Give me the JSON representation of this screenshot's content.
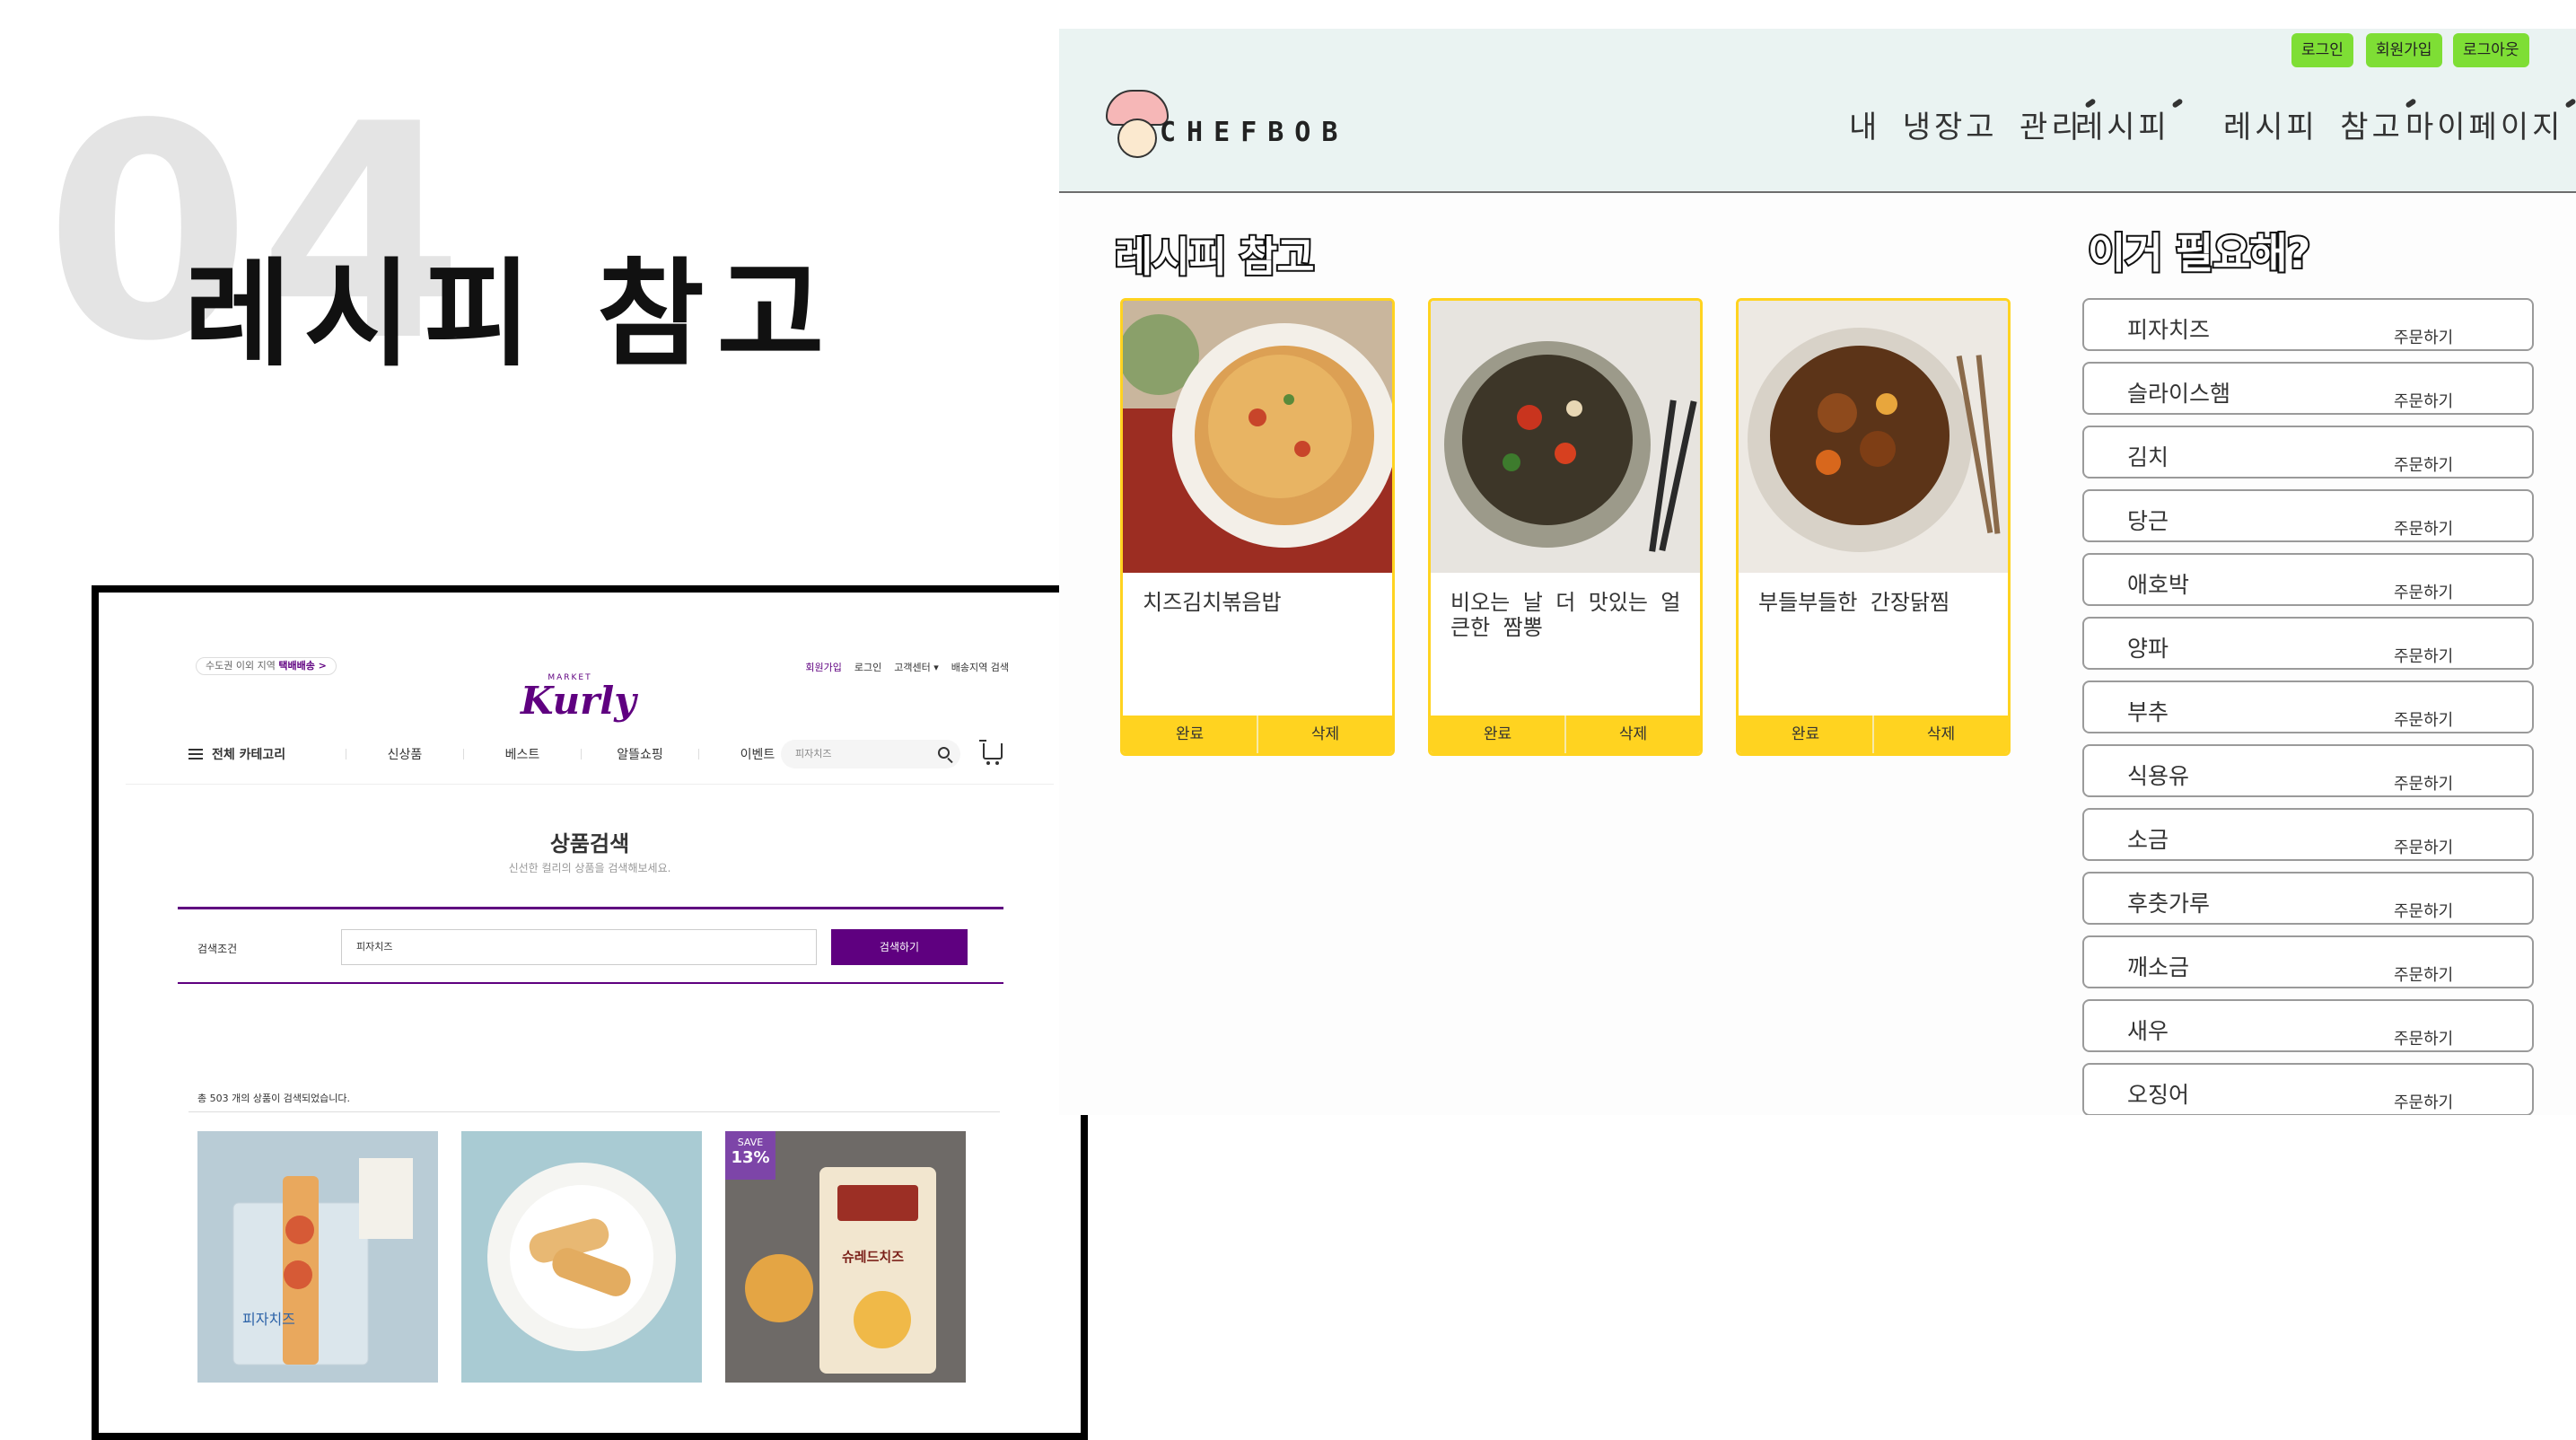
{
  "slide": {
    "number": "04",
    "title": "레시피 참고"
  },
  "kurly": {
    "delivery_text": "수도권 이외 지역",
    "delivery_badge": "택배배송 >",
    "top_links": [
      "회원가입",
      "로그인",
      "고객센터 ▾",
      "배송지역 검색"
    ],
    "logo_small": "MARKET",
    "logo": "Kurly",
    "nav": {
      "category": "전체 카테고리",
      "items": [
        "신상품",
        "베스트",
        "알뜰쇼핑",
        "이벤트"
      ]
    },
    "search_placeholder": "피자치즈",
    "page_title": "상품검색",
    "page_subtitle": "신선한 컬리의 상품을 검색해보세요.",
    "search_label": "검색조건",
    "search_value": "피자치즈",
    "search_button": "검색하기",
    "result_count": "총 503 개의 상품이 검색되었습니다.",
    "save_badge": {
      "line1": "SAVE",
      "line2": "13%"
    },
    "product_texts": [
      "피자치즈",
      "슈레드치즈"
    ]
  },
  "app": {
    "auth": {
      "login": "로그인",
      "signup": "회원가입",
      "logout": "로그아웃"
    },
    "logo": "CHEFBOB",
    "nav": [
      "내 냉장고 관리",
      "레시피",
      "레시피 참고",
      "마이페이지"
    ],
    "section_recipes": "레시피 참고",
    "section_needs": "이거 필요해?",
    "recipes": [
      {
        "name": "치즈김치볶음밥",
        "done": "완료",
        "delete": "삭제"
      },
      {
        "name": "비오는 날 더 맛있는 얼큰한 짬뽕",
        "done": "완료",
        "delete": "삭제"
      },
      {
        "name": "부들부들한 간장닭찜",
        "done": "완료",
        "delete": "삭제"
      }
    ],
    "needs": [
      {
        "name": "피자치즈",
        "order": "주문하기"
      },
      {
        "name": "슬라이스햄",
        "order": "주문하기"
      },
      {
        "name": "김치",
        "order": "주문하기"
      },
      {
        "name": "당근",
        "order": "주문하기"
      },
      {
        "name": "애호박",
        "order": "주문하기"
      },
      {
        "name": "양파",
        "order": "주문하기"
      },
      {
        "name": "부추",
        "order": "주문하기"
      },
      {
        "name": "식용유",
        "order": "주문하기"
      },
      {
        "name": "소금",
        "order": "주문하기"
      },
      {
        "name": "후춧가루",
        "order": "주문하기"
      },
      {
        "name": "깨소금",
        "order": "주문하기"
      },
      {
        "name": "새우",
        "order": "주문하기"
      },
      {
        "name": "오징어",
        "order": "주문하기"
      }
    ]
  },
  "colors": {
    "kurly_purple": "#5f0080",
    "card_yellow": "#ffd320",
    "auth_green": "#7ede35",
    "header_bg": "#eaf3f2"
  }
}
